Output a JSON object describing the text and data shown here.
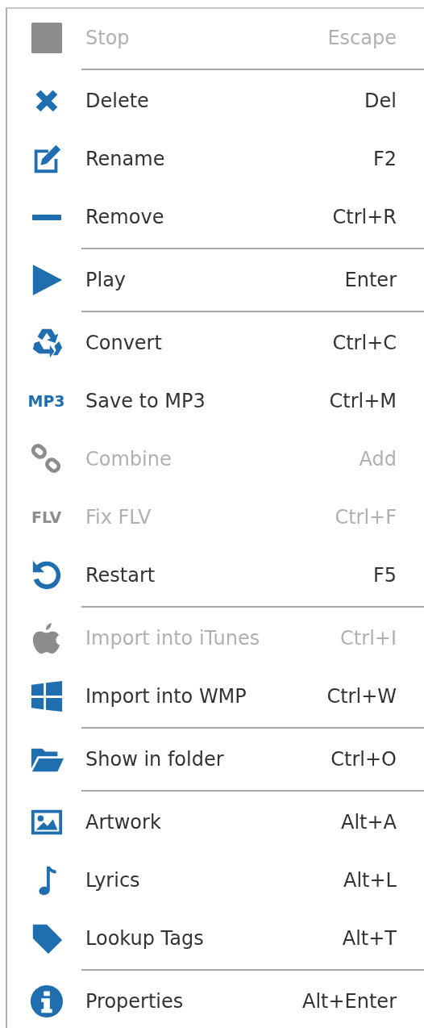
{
  "context_menu": {
    "sections": [
      {
        "items": [
          {
            "label": "Stop",
            "shortcut": "Escape",
            "disabled": true
          }
        ]
      },
      {
        "items": [
          {
            "label": "Delete",
            "shortcut": "Del",
            "disabled": false
          },
          {
            "label": "Rename",
            "shortcut": "F2",
            "disabled": false
          },
          {
            "label": "Remove",
            "shortcut": "Ctrl+R",
            "disabled": false
          }
        ]
      },
      {
        "items": [
          {
            "label": "Play",
            "shortcut": "Enter",
            "disabled": false
          }
        ]
      },
      {
        "items": [
          {
            "label": "Convert",
            "shortcut": "Ctrl+C",
            "disabled": false
          },
          {
            "label": "Save to MP3",
            "shortcut": "Ctrl+M",
            "disabled": false,
            "icon_text": "MP3"
          },
          {
            "label": "Combine",
            "shortcut": "Add",
            "disabled": true
          },
          {
            "label": "Fix FLV",
            "shortcut": "Ctrl+F",
            "disabled": true,
            "icon_text": "FLV"
          },
          {
            "label": "Restart",
            "shortcut": "F5",
            "disabled": false
          }
        ]
      },
      {
        "items": [
          {
            "label": "Import into iTunes",
            "shortcut": "Ctrl+I",
            "disabled": true
          },
          {
            "label": "Import into WMP",
            "shortcut": "Ctrl+W",
            "disabled": false
          }
        ]
      },
      {
        "items": [
          {
            "label": "Show in folder",
            "shortcut": "Ctrl+O",
            "disabled": false
          }
        ]
      },
      {
        "items": [
          {
            "label": "Artwork",
            "shortcut": "Alt+A",
            "disabled": false
          },
          {
            "label": "Lyrics",
            "shortcut": "Alt+L",
            "disabled": false
          },
          {
            "label": "Lookup Tags",
            "shortcut": "Alt+T",
            "disabled": false
          }
        ]
      },
      {
        "items": [
          {
            "label": "Properties",
            "shortcut": "Alt+Enter",
            "disabled": false
          }
        ]
      }
    ]
  }
}
